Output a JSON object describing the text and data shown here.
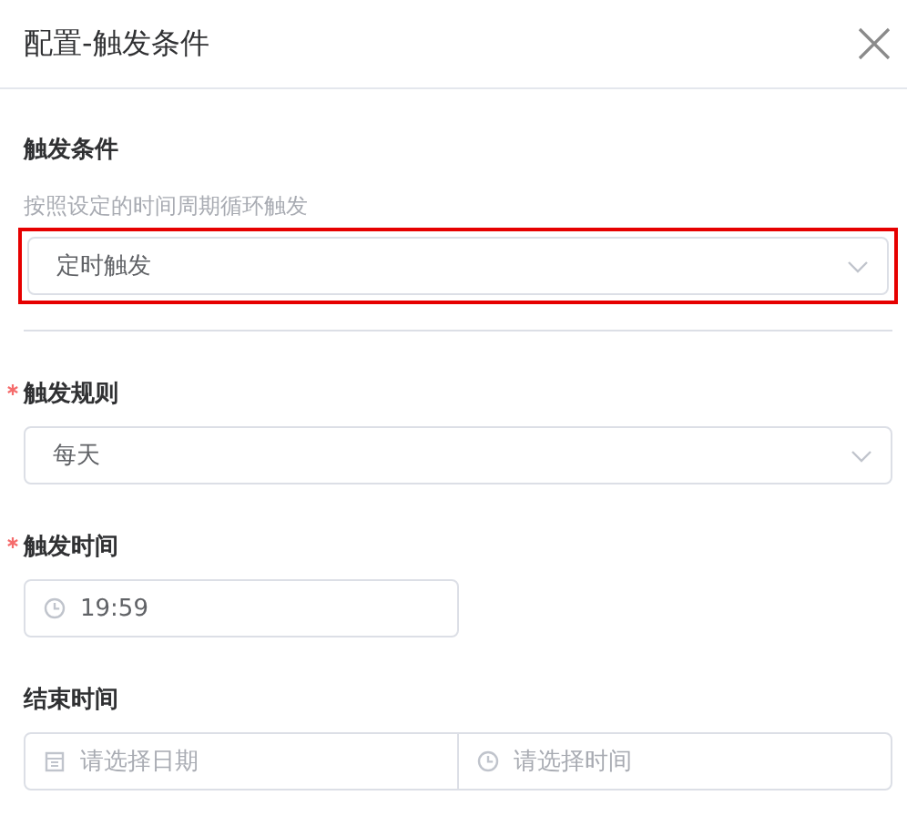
{
  "dialog": {
    "title": "配置-触发条件"
  },
  "condition": {
    "label": "触发条件",
    "hint": "按照设定的时间周期循环触发",
    "value": "定时触发",
    "highlighted": true
  },
  "fields": [
    {
      "kind": "select",
      "label": "触发规则",
      "required": true,
      "value": "每天"
    },
    {
      "kind": "time",
      "label": "触发时间",
      "required": true,
      "value": "19:59"
    },
    {
      "kind": "datetime",
      "label": "结束时间",
      "required": false,
      "date_placeholder": "请选择日期",
      "time_placeholder": "请选择时间"
    }
  ]
}
